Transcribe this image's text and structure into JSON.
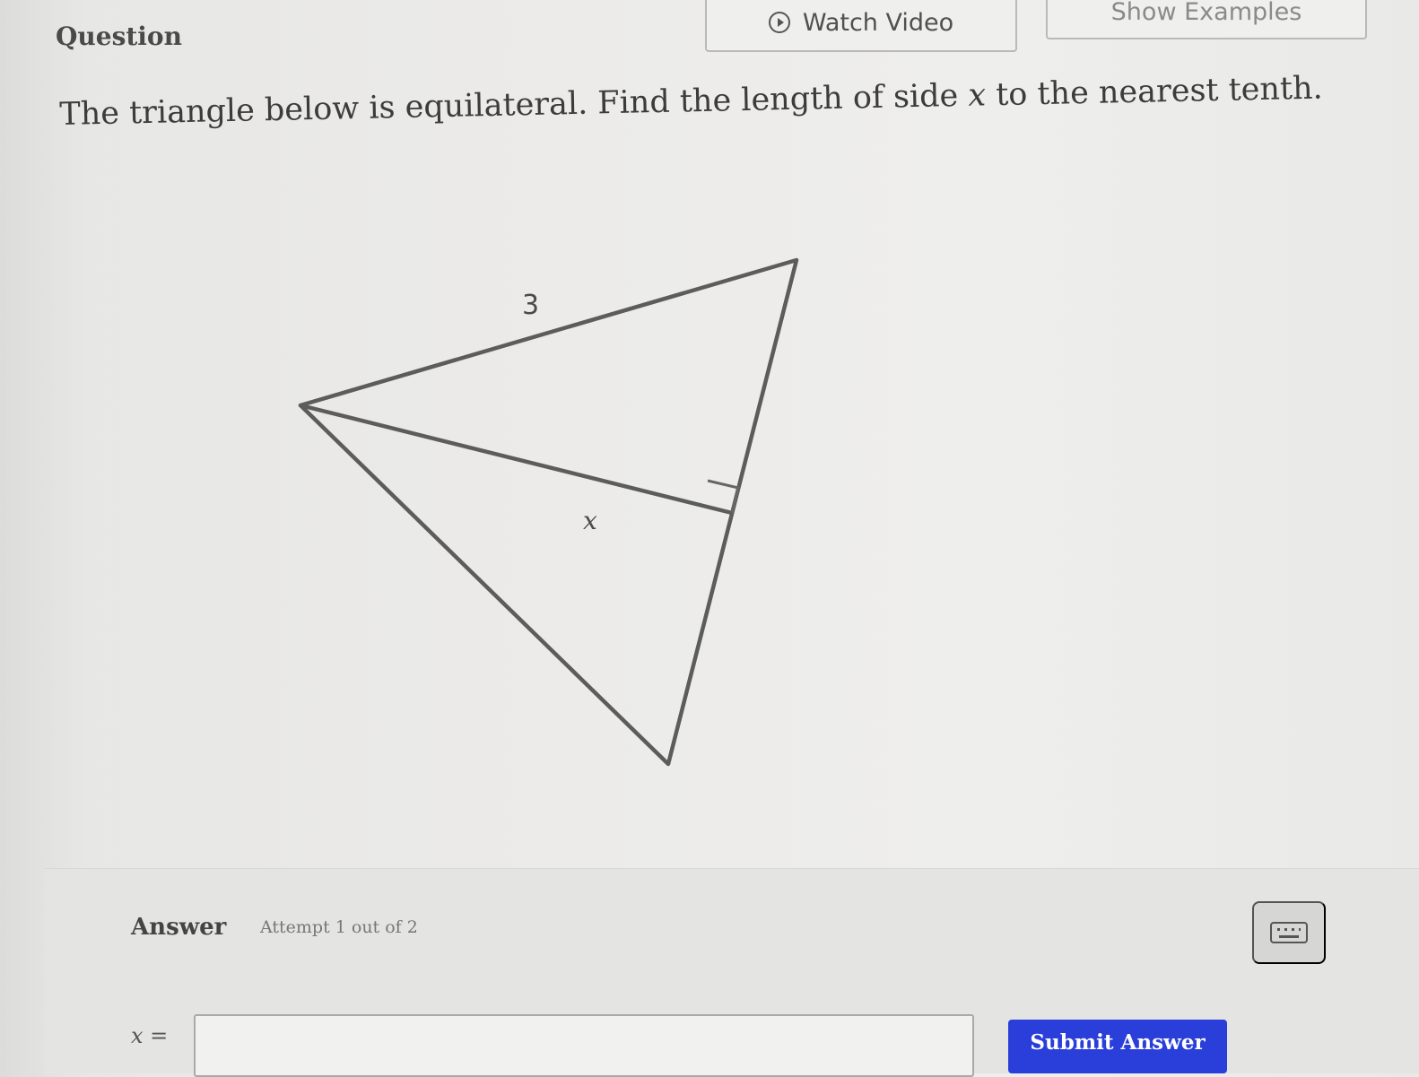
{
  "header": {
    "question_label": "Question",
    "watch_video_label": "Watch Video",
    "show_examples_label": "Show Examples"
  },
  "question": {
    "prompt_before": "The triangle below is equilateral. Find the length of side ",
    "prompt_variable": "x",
    "prompt_after": " to the nearest tenth."
  },
  "diagram": {
    "side_label": "3",
    "altitude_label": "x"
  },
  "answer": {
    "label": "Answer",
    "attempt_text": "Attempt 1 out of 2",
    "input_variable": "x",
    "input_equals": " =",
    "input_value": "",
    "submit_label": "Submit Answer"
  }
}
